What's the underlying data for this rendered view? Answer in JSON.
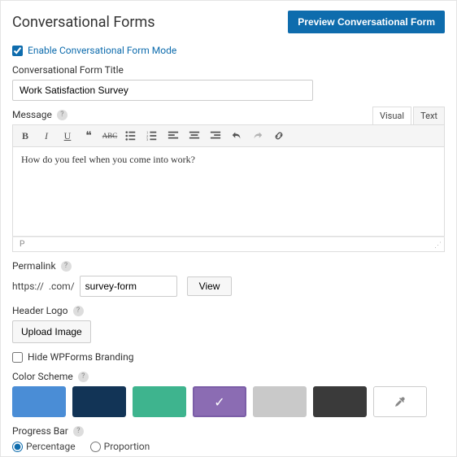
{
  "header": {
    "title": "Conversational Forms",
    "preview_btn": "Preview Conversational Form"
  },
  "enable": {
    "label": "Enable Conversational Form Mode",
    "checked": true
  },
  "title_field": {
    "label": "Conversational Form Title",
    "value": "Work Satisfaction Survey"
  },
  "message": {
    "label": "Message",
    "tabs": {
      "visual": "Visual",
      "text": "Text"
    },
    "content": "How do you feel when you come into work?",
    "status": "P"
  },
  "permalink": {
    "label": "Permalink",
    "prefix": "https://",
    "domain": ".com/",
    "slug": "survey-form",
    "view_btn": "View"
  },
  "header_logo": {
    "label": "Header Logo",
    "upload_btn": "Upload Image"
  },
  "hide_branding": {
    "label": "Hide WPForms Branding",
    "checked": false
  },
  "color_scheme": {
    "label": "Color Scheme",
    "colors": [
      "#4a8dd6",
      "#123456",
      "#3eb48e",
      "#8b6cb3",
      "#c9c9c9",
      "#3a3a3a"
    ],
    "selected_index": 3
  },
  "progress_bar": {
    "label": "Progress Bar",
    "options": {
      "percentage": "Percentage",
      "proportion": "Proportion"
    },
    "selected": "percentage"
  }
}
